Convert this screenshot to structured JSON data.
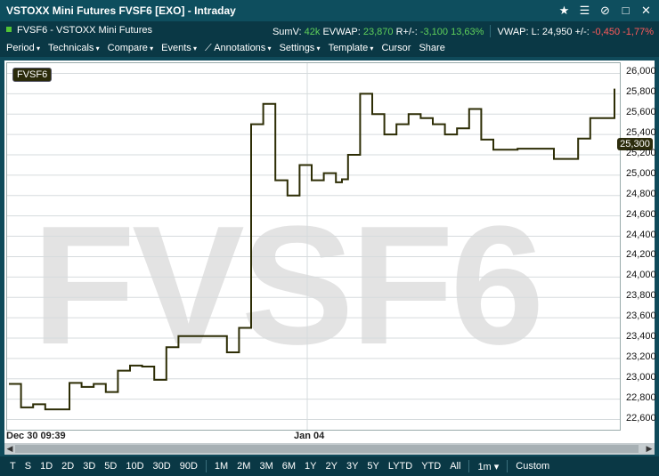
{
  "window": {
    "title": "VSTOXX Mini Futures  FVSF6 [EXO] - Intraday",
    "icons": [
      "star-icon",
      "list-icon",
      "unlink-icon",
      "maximize-icon",
      "close-icon"
    ]
  },
  "info": {
    "instrument": "FVSF6 - VSTOXX Mini Futures",
    "sumv_label": "SumV:",
    "sumv": "42k",
    "evwap_label": "EVWAP:",
    "evwap": "23,870",
    "rpm_label": "R+/-:",
    "rpm": "-3,100",
    "rpm_pct": "13,63%",
    "vwap_label": "VWAP:",
    "last_label": "L:",
    "last": "24,950",
    "chg_label": "+/-:",
    "chg": "-0,450",
    "chg_pct": "-1,77%"
  },
  "toolbar": {
    "items": [
      "Period",
      "Technicals",
      "Compare",
      "Events",
      "Annotations",
      "Settings",
      "Template",
      "Cursor",
      "Share"
    ]
  },
  "chart": {
    "symbol": "FVSF6",
    "watermark": "FVSF6",
    "last_label": "25,300",
    "x_start": "Dec 30 09:39",
    "x_mid": "Jan 04"
  },
  "chart_data": {
    "type": "line",
    "title": "",
    "xlabel": "",
    "ylabel": "",
    "ylim": [
      22500,
      26100
    ],
    "yticks": [
      "26,000",
      "25,800",
      "25,600",
      "25,400",
      "25,200",
      "25,000",
      "24,800",
      "24,600",
      "24,400",
      "24,200",
      "24,000",
      "23,800",
      "23,600",
      "23,400",
      "23,200",
      "23,000",
      "22,800",
      "22,600"
    ],
    "x": [
      0,
      2,
      4,
      6,
      8,
      10,
      12,
      14,
      16,
      18,
      20,
      22,
      24,
      26,
      28,
      30,
      32,
      34,
      36,
      37,
      38,
      40,
      42,
      44,
      46,
      48,
      50,
      52,
      54,
      55,
      56,
      58,
      60,
      62,
      64,
      66,
      68,
      70,
      72,
      74,
      76,
      78,
      80,
      82,
      84,
      86,
      88,
      90,
      92,
      94,
      96,
      98,
      100
    ],
    "series": [
      {
        "values": [
          22950,
          22720,
          22750,
          22700,
          22700,
          22960,
          22920,
          22950,
          22870,
          23080,
          23130,
          23120,
          22990,
          23310,
          23420,
          23420,
          23420,
          23420,
          23260,
          23260,
          23500,
          25500,
          25700,
          24950,
          24800,
          25100,
          24950,
          25020,
          24930,
          24960,
          25200,
          25800,
          25600,
          25400,
          25500,
          25600,
          25560,
          25500,
          25400,
          25460,
          25650,
          25350,
          25250,
          25250,
          25260,
          25260,
          25260,
          25160,
          25160,
          25360,
          25560,
          25560,
          25850
        ]
      }
    ]
  }
}
